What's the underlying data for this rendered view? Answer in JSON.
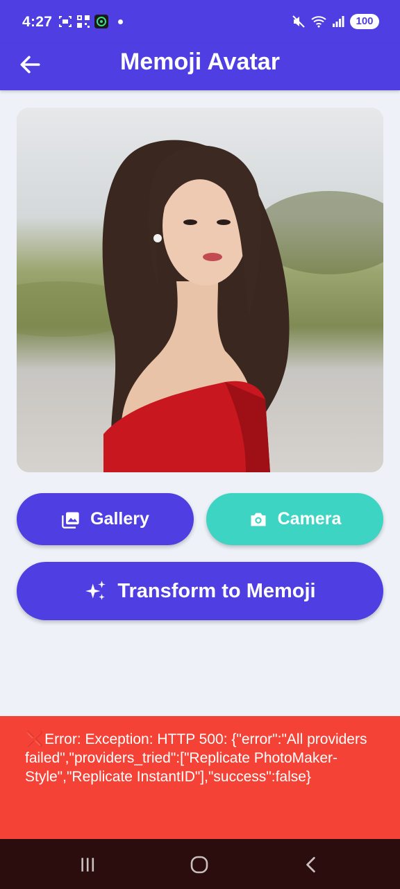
{
  "status_bar": {
    "time": "4:27",
    "battery": "100",
    "icons": [
      "screenshot-icon",
      "qr-code-icon",
      "app-icon",
      "notification-dot",
      "mute-icon",
      "wifi-icon",
      "signal-icon",
      "battery-icon"
    ]
  },
  "app_bar": {
    "title": "Memoji Avatar",
    "back_icon": "arrow-back-icon"
  },
  "colors": {
    "accent": "#4f3fe3",
    "camera": "#3dd4c4",
    "error": "#f44336",
    "background": "#eef2f8",
    "navbar": "#2a0d0c"
  },
  "buttons": {
    "gallery": {
      "label": "Gallery",
      "icon": "image-icon"
    },
    "camera": {
      "label": "Camera",
      "icon": "camera-icon"
    },
    "transform": {
      "label": "Transform to Memoji",
      "icon": "sparkles-icon"
    }
  },
  "error": {
    "icon": "❌",
    "message": "Error: Exception: HTTP 500: {\"error\":\"All providers failed\",\"providers_tried\":[\"Replicate PhotoMaker-Style\",\"Replicate InstantID\"],\"success\":false}"
  },
  "nav_bar": {
    "buttons": [
      "recent-apps-icon",
      "home-icon",
      "back-icon"
    ]
  }
}
